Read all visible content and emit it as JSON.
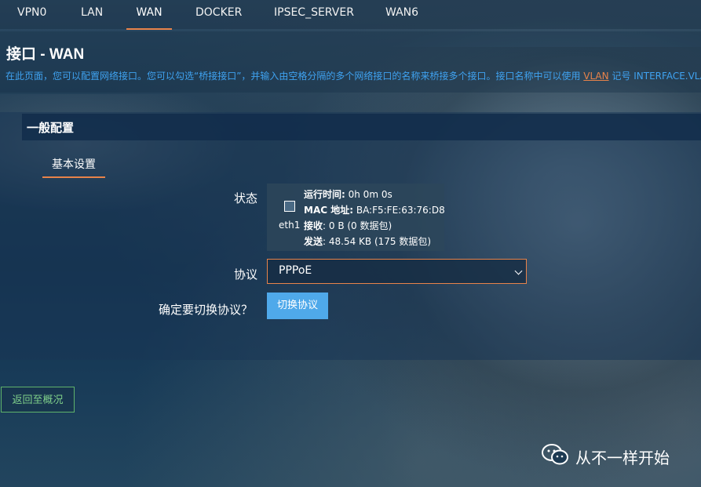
{
  "nav": {
    "tabs": [
      "VPN0",
      "LAN",
      "WAN",
      "DOCKER",
      "IPSEC_SERVER",
      "WAN6"
    ],
    "active": "WAN"
  },
  "header": {
    "title": "接口 - WAN",
    "desc_prefix": "在此页面，您可以配置网络接口。您可以勾选“桥接接口”，并输入由空格分隔的多个网络接口的名称来桥接多个接口。接口名称中可以使用 ",
    "desc_link": "VLAN",
    "desc_suffix": " 记号 INTERFACE.VLANNR"
  },
  "section": {
    "title": "一般配置",
    "subtab": "基本设置"
  },
  "status": {
    "label": "状态",
    "interface": "eth1",
    "uptime_key": "运行时间:",
    "uptime_val": " 0h 0m 0s",
    "mac_key": "MAC 地址:",
    "mac_val": " BA:F5:FE:63:76:D8",
    "rx_key": "接收",
    "rx_val": ": 0 B (0 数据包)",
    "tx_key": "发送",
    "tx_val": ": 48.54 KB (175 数据包)"
  },
  "protocol": {
    "label": "协议",
    "selected": "PPPoE"
  },
  "switch": {
    "label": "确定要切换协议？",
    "button": "切换协议"
  },
  "back_button": "返回至概况",
  "watermark": {
    "text": "从不一样开始",
    "icon": "wechat-icon"
  },
  "colors": {
    "accent": "#e8834a",
    "link": "#3fa2f0",
    "button": "#4fa9ea",
    "back": "#5fb36b"
  }
}
